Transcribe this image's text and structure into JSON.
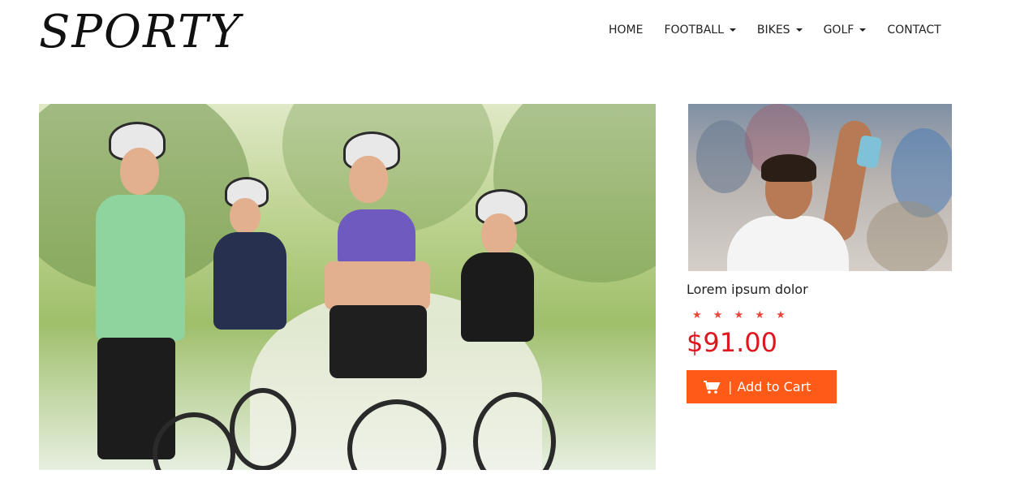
{
  "brand": {
    "logo_text": "SPORTY"
  },
  "nav": {
    "items": [
      {
        "label": "HOME",
        "has_dropdown": false
      },
      {
        "label": "FOOTBALL",
        "has_dropdown": true
      },
      {
        "label": "BIKES",
        "has_dropdown": true
      },
      {
        "label": "GOLF",
        "has_dropdown": true
      },
      {
        "label": "CONTACT",
        "has_dropdown": false
      }
    ]
  },
  "hero": {
    "image": "cyclists-riding-bikes-in-park"
  },
  "product": {
    "image": "tennis-player-waving",
    "title": "Lorem ipsum dolor",
    "rating": 5,
    "rating_max": 5,
    "stars_text": "★ ★ ★ ★ ★",
    "price": "$91.00",
    "cart": {
      "icon": "cart-icon",
      "separator": "|",
      "label": "Add to Cart"
    }
  },
  "colors": {
    "accent": "#ff5a17",
    "price": "#e0161e",
    "stars": "#e8473a"
  }
}
